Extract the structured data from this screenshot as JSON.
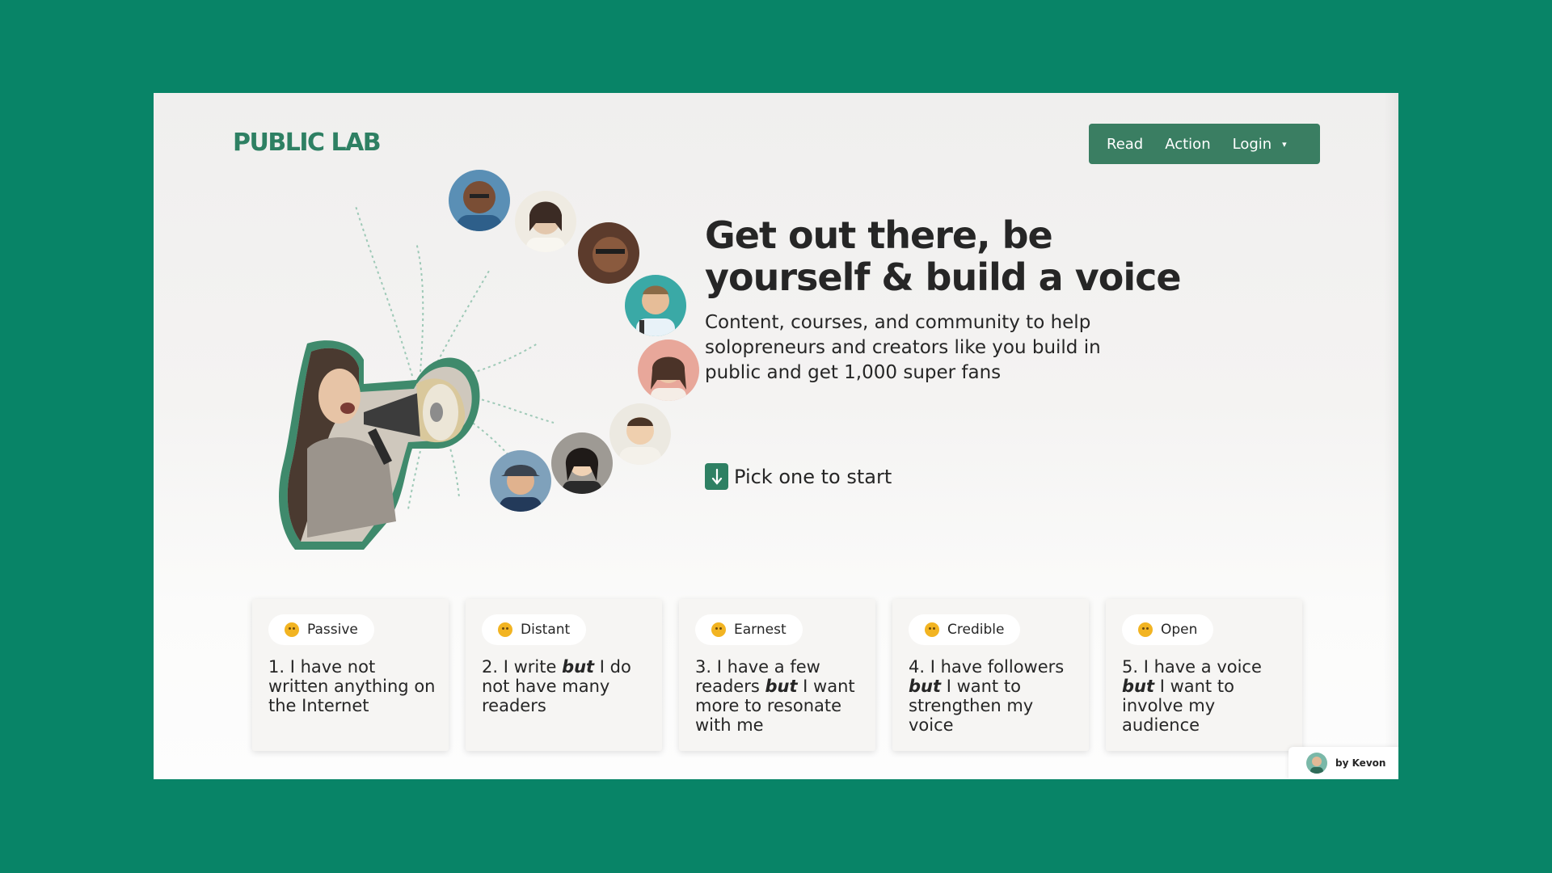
{
  "brand": {
    "logo": "PUBLIC LAB",
    "accent_color": "#2e8063",
    "background_color": "#088467"
  },
  "nav": {
    "items": [
      {
        "label": "Read"
      },
      {
        "label": "Action"
      },
      {
        "label": "Login"
      }
    ],
    "caret": "▾"
  },
  "hero": {
    "headline": "Get out there, be yourself & build a voice",
    "subtext": "Content, courses, and community to help solopreneurs and creators like you build in public and get 1,000 super fans",
    "cta": {
      "icon": "arrow-down-icon",
      "label": "Pick one to start"
    }
  },
  "cards": [
    {
      "mood": "Passive",
      "text_html": "1. I have not written anything on the Internet"
    },
    {
      "mood": "Distant",
      "text_html": "2. I write <em>but</em> I do not have many readers"
    },
    {
      "mood": "Earnest",
      "text_html": "3. I have a few readers <em>but</em> I want more to resonate with me"
    },
    {
      "mood": "Credible",
      "text_html": "4. I have followers <em>but</em> I want to strengthen my voice"
    },
    {
      "mood": "Open",
      "text_html": "5. I have a voice <em>but</em> I want to involve my audience"
    }
  ],
  "credit": {
    "label": "by Kevon"
  }
}
